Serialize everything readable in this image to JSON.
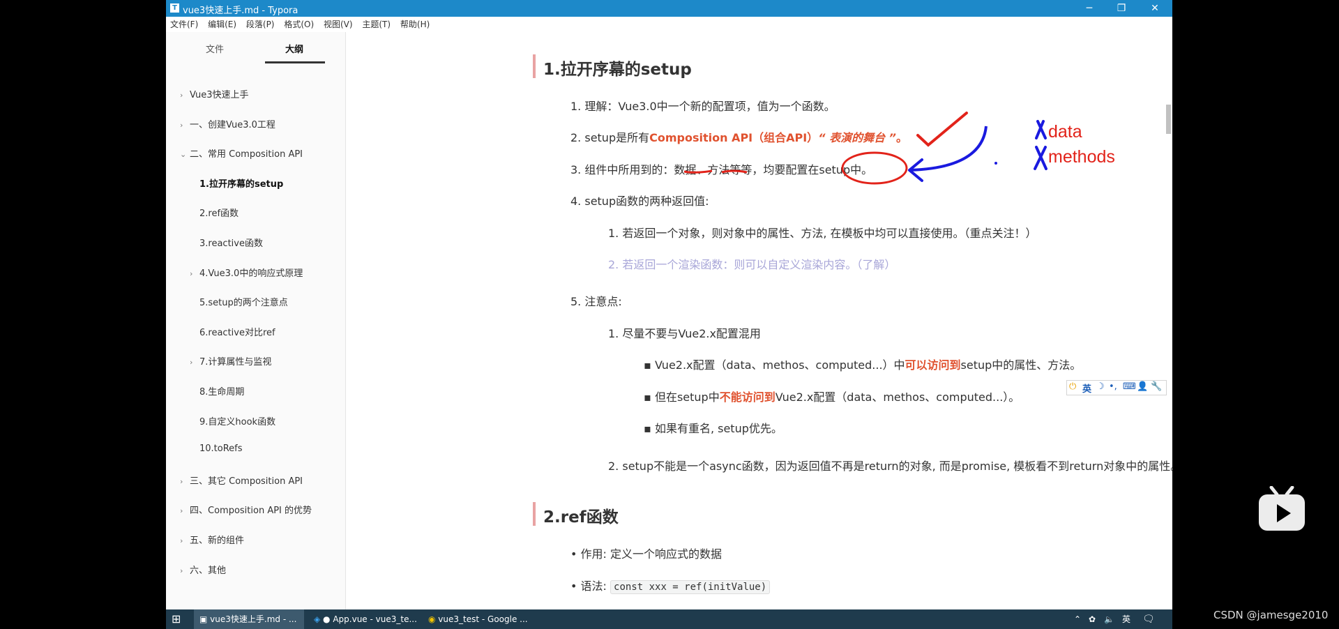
{
  "window": {
    "title": "vue3快速上手.md - Typora",
    "controls": [
      "minimize-icon",
      "restore-icon",
      "close-icon"
    ]
  },
  "menu": [
    "文件(F)",
    "编辑(E)",
    "段落(P)",
    "格式(O)",
    "视图(V)",
    "主题(T)",
    "帮助(H)"
  ],
  "sidebar": {
    "tabs": [
      "文件",
      "大纲"
    ],
    "active_tab": "大纲",
    "outline": [
      {
        "label": "Vue3快速上手",
        "chevron": "›",
        "level": 0
      },
      {
        "label": "一、创建Vue3.0工程",
        "chevron": "›",
        "level": 0
      },
      {
        "label": "二、常用 Composition API",
        "chevron": "⌄",
        "level": 0
      },
      {
        "label": "1.拉开序幕的setup",
        "chevron": "",
        "level": 1,
        "active": true
      },
      {
        "label": "2.ref函数",
        "chevron": "",
        "level": 1
      },
      {
        "label": "3.reactive函数",
        "chevron": "",
        "level": 1
      },
      {
        "label": "4.Vue3.0中的响应式原理",
        "chevron": "›",
        "level": 1
      },
      {
        "label": "5.setup的两个注意点",
        "chevron": "",
        "level": 1
      },
      {
        "label": "6.reactive对比ref",
        "chevron": "",
        "level": 1
      },
      {
        "label": "7.计算属性与监视",
        "chevron": "›",
        "level": 1
      },
      {
        "label": "8.生命周期",
        "chevron": "",
        "level": 1
      },
      {
        "label": "9.自定义hook函数",
        "chevron": "",
        "level": 1
      },
      {
        "label": "10.toRefs",
        "chevron": "",
        "level": 1
      },
      {
        "label": "三、其它 Composition API",
        "chevron": "›",
        "level": 0
      },
      {
        "label": "四、Composition API 的优势",
        "chevron": "›",
        "level": 0
      },
      {
        "label": "五、新的组件",
        "chevron": "›",
        "level": 0
      },
      {
        "label": "六、其他",
        "chevron": "›",
        "level": 0
      }
    ]
  },
  "doc": {
    "h1": "1.拉开序幕的setup",
    "item1": "1. 理解：Vue3.0中一个新的配置项，值为一个函数。",
    "item2_pre": "2. setup是所有",
    "item2_api": "Composition API（组合API）",
    "item2_quote": "“ 表演的舞台 ”",
    "item2_end": "。",
    "item3": "3. 组件中所用到的：数据、方法等等，均要配置在setup中。",
    "item4": "4. setup函数的两种返回值:",
    "item4_1": "1. 若返回一个对象，则对象中的属性、方法, 在模板中均可以直接使用。（重点关注！）",
    "item4_2": "2. 若返回一个渲染函数：则可以自定义渲染内容。（了解）",
    "item5": "5. 注意点:",
    "item5_1": "1. 尽量不要与Vue2.x配置混用",
    "b1_pre": "Vue2.x配置（data、methos、computed...）中",
    "b1_hl": "可以访问到",
    "b1_end": "setup中的属性、方法。",
    "b2_pre": "但在setup中",
    "b2_hl": "不能访问到",
    "b2_end": "Vue2.x配置（data、methos、computed...）。",
    "b3": "如果有重名, setup优先。",
    "item5_2": "2. setup不能是一个async函数，因为返回值不再是return的对象, 而是promise, 模板看不到return对象中的属性。",
    "h2": "2.ref函数",
    "ref_b1": "作用: 定义一个响应式的数据",
    "ref_b2_label": "语法: ",
    "ref_b2_code": "const xxx = ref(initValue)"
  },
  "annotations": {
    "text_data": "data",
    "text_methods": "methods",
    "ink_red": "#e2231a",
    "ink_blue": "#1a1adf"
  },
  "ime": {
    "lang": "英"
  },
  "taskbar": {
    "apps": [
      "vue3快速上手.md - ...",
      "● App.vue - vue3_te...",
      "vue3_test - Google ..."
    ],
    "tray_lang": "英"
  },
  "watermark": "CSDN @jamesge2010",
  "colors": {
    "titlebar": "#1d89c9",
    "accent": "#e0522f",
    "muted": "#a8a6d8",
    "taskbar": "#1f3b4d"
  }
}
